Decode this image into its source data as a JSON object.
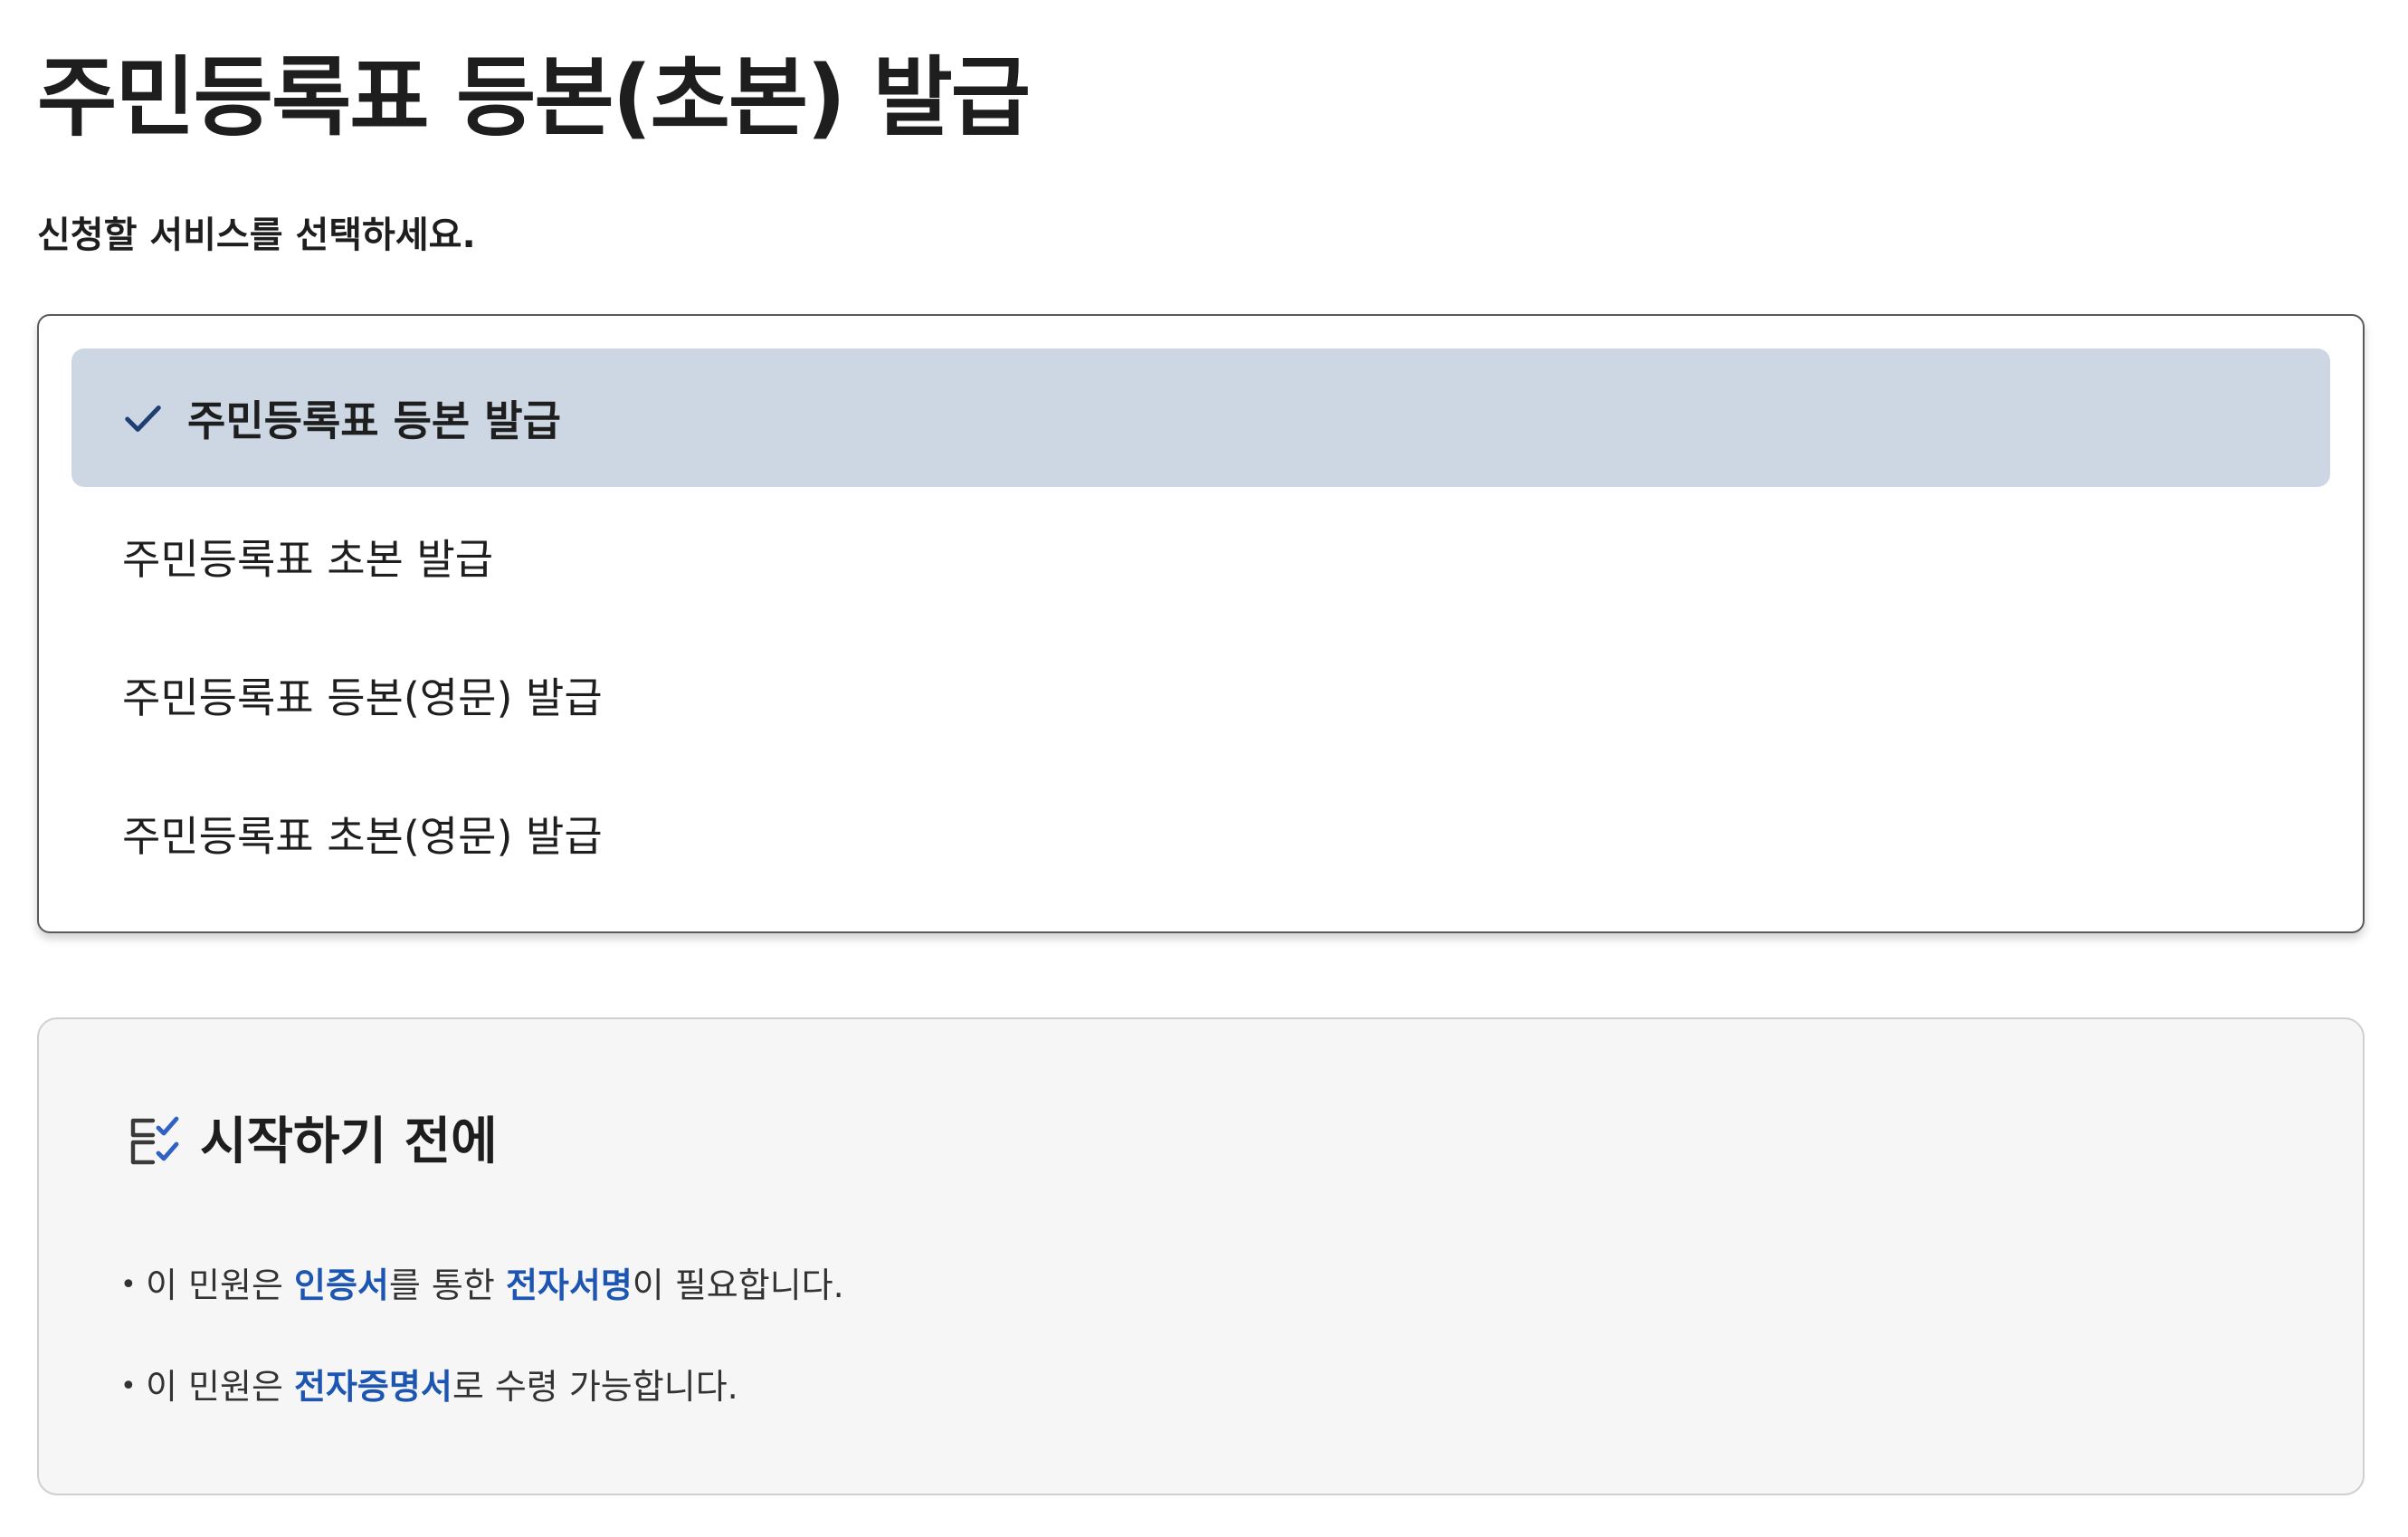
{
  "page": {
    "title": "주민등록표 등본(초본) 발급",
    "subtitle": "신청할 서비스를 선택하세요."
  },
  "options": [
    {
      "label": "주민등록표 등본 발급",
      "selected": true
    },
    {
      "label": "주민등록표 초본 발급",
      "selected": false
    },
    {
      "label": "주민등록표 등본(영문) 발급",
      "selected": false
    },
    {
      "label": "주민등록표 초본(영문) 발급",
      "selected": false
    }
  ],
  "info": {
    "title": "시작하기 전에",
    "notices": [
      {
        "before": "이 민원은 ",
        "highlight1": "인증서",
        "middle": "를 통한 ",
        "highlight2": "전자서명",
        "after": "이 필요합니다."
      },
      {
        "before": "이 민원은 ",
        "highlight1": "전자증명서",
        "after": "로 수령 가능합니다."
      }
    ]
  },
  "colors": {
    "selected_bg": "#cdd7e3",
    "highlight": "#1d56b2",
    "check": "#1f3f73"
  },
  "icons": {
    "check": "check-icon",
    "checklist": "checklist-icon"
  }
}
